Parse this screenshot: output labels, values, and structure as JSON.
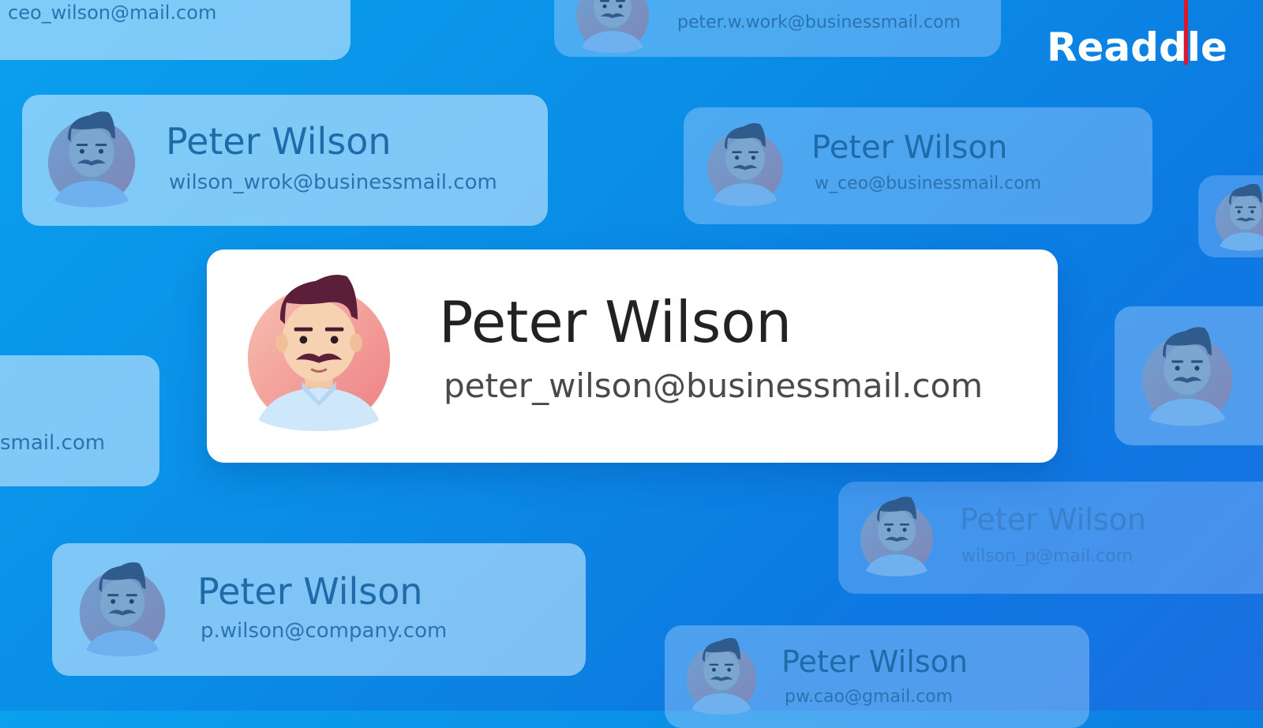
{
  "brand": {
    "logo_text": "Readdle",
    "accent_color": "#e0142b"
  },
  "main_card": {
    "name": "Peter Wilson",
    "email": "peter_wilson@businessmail.com",
    "avatar_icon": "man-avatar-icon"
  },
  "bg_cards": [
    {
      "email": "ceo_wilson@mail.com"
    },
    {
      "email": "peter.w.work@businessmail.com"
    },
    {
      "name": "Peter Wilson",
      "email": "wilson_wrok@businessmail.com"
    },
    {
      "name": "Peter Wilson",
      "email": "w_ceo@businessmail.com"
    },
    {
      "email": "smail.com"
    },
    {
      "name": "Peter Wilson",
      "email": "wilson_p@mail.com"
    },
    {
      "name": "Peter Wilson",
      "email": "p.wilson@company.com"
    },
    {
      "name": "Peter Wilson",
      "email": "pw.cao@gmail.com"
    }
  ],
  "colors": {
    "background_start": "#0aa0ee",
    "background_end": "#1a6fe0",
    "card_white": "#ffffff"
  }
}
